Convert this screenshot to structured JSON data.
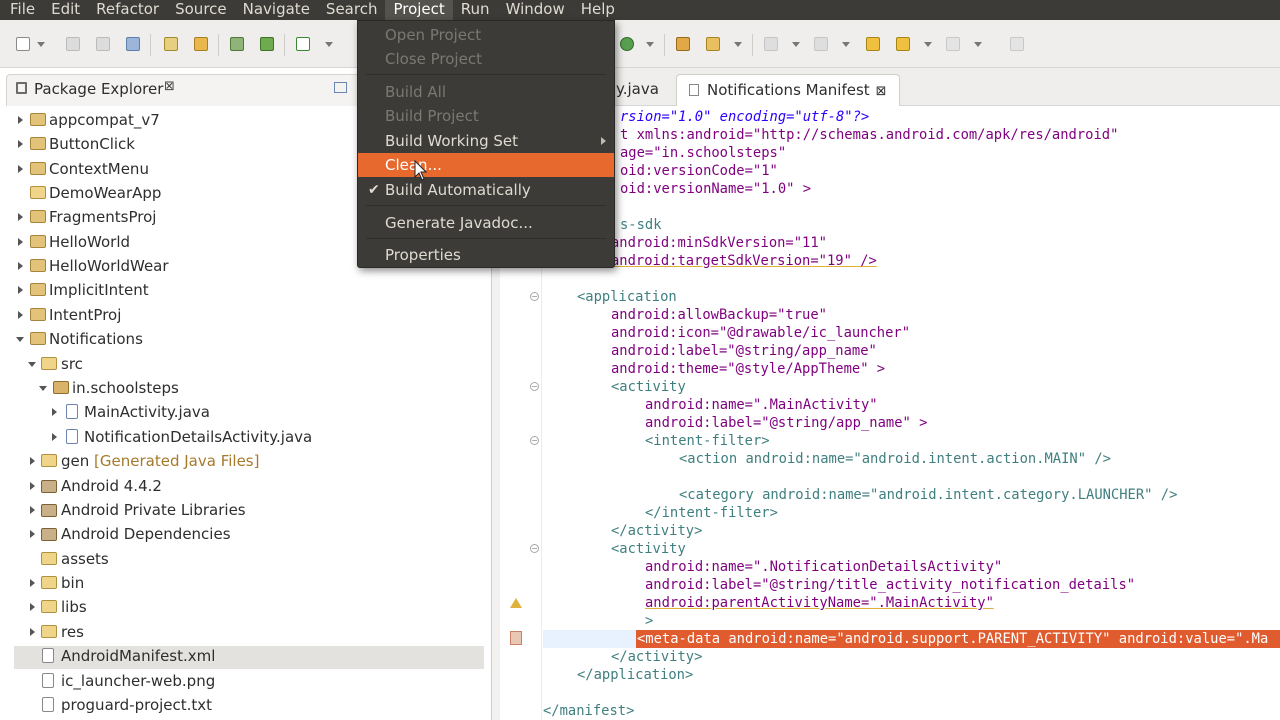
{
  "menubar": {
    "items": [
      "File",
      "Edit",
      "Refactor",
      "Source",
      "Navigate",
      "Search",
      "Project",
      "Run",
      "Window",
      "Help"
    ],
    "active": "Project"
  },
  "project_menu": {
    "open_project": "Open Project",
    "close_project": "Close Project",
    "build_all": "Build All",
    "build_project": "Build Project",
    "build_working_set": "Build Working Set",
    "clean": "Clean...",
    "build_automatically": "Build Automatically",
    "generate_javadoc": "Generate Javadoc...",
    "properties": "Properties"
  },
  "package_explorer": {
    "title": "Package Explorer",
    "close": "⊠",
    "items": [
      {
        "label": "appcompat_v7"
      },
      {
        "label": "ButtonClick"
      },
      {
        "label": "ContextMenu"
      },
      {
        "label": "DemoWearApp"
      },
      {
        "label": "FragmentsProj"
      },
      {
        "label": "HelloWorld"
      },
      {
        "label": "HelloWorldWear"
      },
      {
        "label": "ImplicitIntent"
      },
      {
        "label": "IntentProj"
      },
      {
        "label": "Notifications"
      },
      {
        "label": "src"
      },
      {
        "label": "in.schoolsteps"
      },
      {
        "label": "MainActivity.java"
      },
      {
        "label": "NotificationDetailsActivity.java"
      },
      {
        "label": "gen",
        "note": "[Generated Java Files]"
      },
      {
        "label": "Android 4.4.2"
      },
      {
        "label": "Android Private Libraries"
      },
      {
        "label": "Android Dependencies"
      },
      {
        "label": "assets"
      },
      {
        "label": "bin"
      },
      {
        "label": "libs"
      },
      {
        "label": "res"
      },
      {
        "label": "AndroidManifest.xml"
      },
      {
        "label": "ic_launcher-web.png"
      },
      {
        "label": "proguard-project.txt"
      }
    ]
  },
  "editor": {
    "tabs": [
      {
        "label": "y.java"
      },
      {
        "label": "Notifications Manifest",
        "close": "⊠"
      }
    ],
    "lines": [
      "rsion=\"1.0\" encoding=\"utf-8\"?>",
      "t xmlns:android=\"http://schemas.android.com/apk/res/android\"",
      "age=\"in.schoolsteps\"",
      "oid:versionCode=\"1\"",
      "oid:versionName=\"1.0\" >",
      "s-sdk",
      "android:minSdkVersion=\"11\"",
      "android:targetSdkVersion=\"19\" />",
      "<application",
      "android:allowBackup=\"true\"",
      "android:icon=\"@drawable/ic_launcher\"",
      "android:label=\"@string/app_name\"",
      "android:theme=\"@style/AppTheme\" >",
      "<activity",
      "android:name=\".MainActivity\"",
      "android:label=\"@string/app_name\" >",
      "<intent-filter>",
      "<action android:name=\"android.intent.action.MAIN\" />",
      "<category android:name=\"android.intent.category.LAUNCHER\" />",
      "</intent-filter>",
      "</activity>",
      "<activity",
      "android:name=\".NotificationDetailsActivity\"",
      "android:label=\"@string/title_activity_notification_details\"",
      "android:parentActivityName=\".MainActivity\"",
      ">",
      "<meta-data android:name=\"android.support.PARENT_ACTIVITY\" android:value=\".Ma",
      "</activity>",
      "</application>",
      "</manifest>"
    ]
  },
  "colors": {
    "menubar_bg": "#3c3b37",
    "menu_highlight": "#e8692d",
    "error_line": "#e05b2e"
  }
}
